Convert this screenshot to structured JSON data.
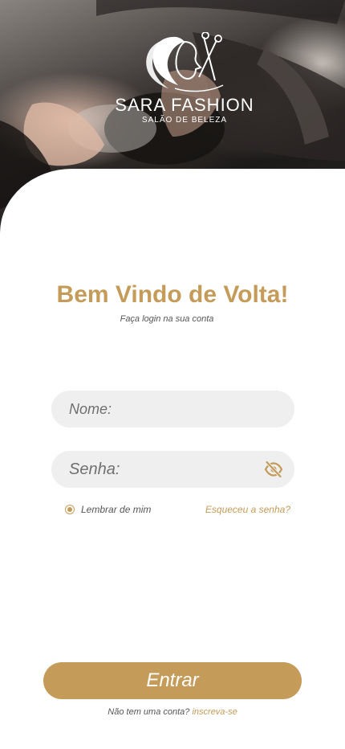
{
  "brand": {
    "name": "SARA FASHION",
    "tagline": "SALÃO DE BELEZA"
  },
  "header": {
    "title": "Bem Vindo de Volta!",
    "subtitle": "Faça login na sua conta"
  },
  "form": {
    "name_placeholder": "Nome:",
    "password_placeholder": "Senha:",
    "name_value": "",
    "password_value": "",
    "remember_label": "Lembrar de mim",
    "remember_checked": true,
    "forgot_label": "Esqueceu a senha?",
    "submit_label": "Entrar"
  },
  "footer": {
    "prompt": "Não tem uma conta?",
    "signup_label": "inscreva-se"
  },
  "colors": {
    "accent": "#c59b5a",
    "field_bg": "#efefef",
    "text_muted": "#555555"
  },
  "icons": {
    "password_toggle": "eye-off-icon",
    "logo": "woman-silhouette-scissors-icon"
  }
}
